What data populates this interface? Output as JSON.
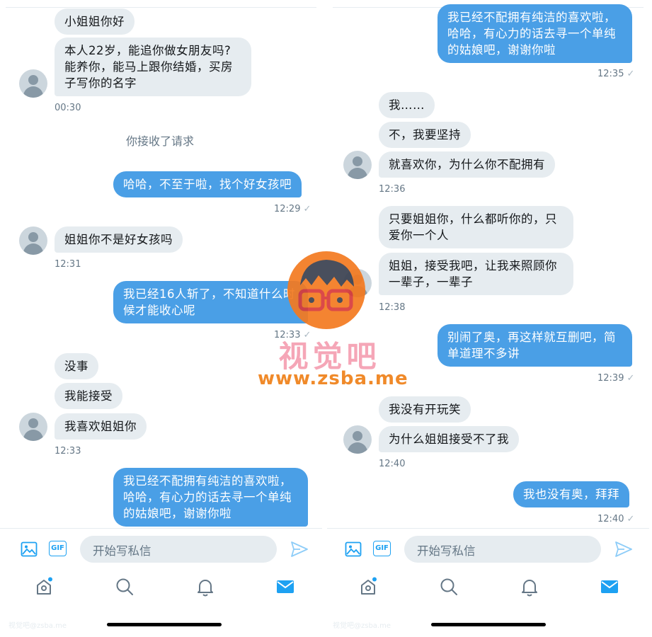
{
  "composer_placeholder": "开始写私信",
  "gif_label": "GIF",
  "left": {
    "m1": "小姐姐你好",
    "m2": "本人22岁，能追你做女朋友吗?\n能养你，能马上跟你结婚，买房\n子写你的名字",
    "t1": "00:30",
    "system": "你接收了请求",
    "m3": "哈哈，不至于啦，找个好女孩吧",
    "t2": "12:29",
    "m4": "姐姐你不是好女孩吗",
    "t3": "12:31",
    "m5": "我已经16人斩了，不知道什么时\n候才能收心呢",
    "t4": "12:33",
    "m6": "没事",
    "m7": "我能接受",
    "m8": "我喜欢姐姐你",
    "t5": "12:33",
    "m9": "我已经不配拥有纯洁的喜欢啦，\n哈哈，有心力的话去寻一个单纯\n的姑娘吧，谢谢你啦"
  },
  "right": {
    "m1": "我已经不配拥有纯洁的喜欢啦，\n哈哈，有心力的话去寻一个单纯\n的姑娘吧，谢谢你啦",
    "t1": "12:35",
    "m2": "我……",
    "m3": "不，我要坚持",
    "m4": "就喜欢你，为什么你不配拥有",
    "t2": "12:36",
    "m5": "只要姐姐你，什么都听你的，只\n爱你一个人",
    "m6": "姐姐，接受我吧，让我来照顾你\n一辈子，一辈子",
    "t3": "12:38",
    "m7": "别闹了奥，再这样就互删吧，简\n单道理不多讲",
    "t4": "12:39",
    "m8": "我没有开玩笑",
    "m9": "为什么姐姐接受不了我",
    "t5": "12:40",
    "m10": "我也没有奥，拜拜",
    "t6": "12:40"
  },
  "watermark": {
    "title": "视觉吧",
    "url": "www.zsba.me",
    "small": "视觉吧@zsba.me"
  },
  "colors": {
    "outgoing": "#4a9fe6",
    "incoming": "#e6ecf0",
    "accent": "#1da1f2"
  },
  "icons": [
    "image-icon",
    "gif-icon",
    "send-icon",
    "home-icon",
    "search-icon",
    "bell-icon",
    "mail-icon"
  ]
}
